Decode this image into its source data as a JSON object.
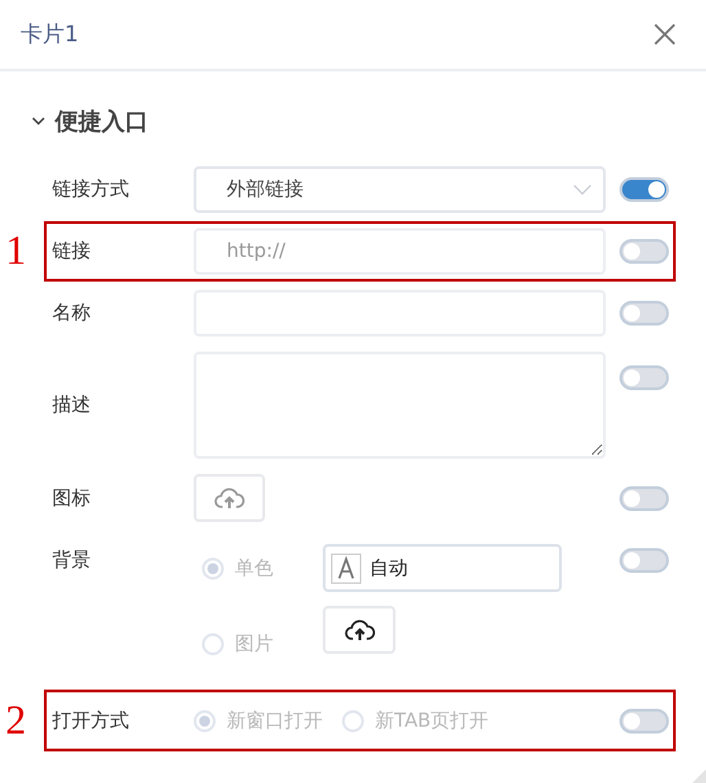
{
  "dialog": {
    "title": "卡片1"
  },
  "section": {
    "title": "便捷入口",
    "expanded": true
  },
  "fields": [
    {
      "kind": "select",
      "label": "链接方式",
      "value": "外部链接",
      "on": true
    },
    {
      "kind": "input",
      "label": "链接",
      "placeholder": "http://",
      "on": false,
      "annotation": "1"
    },
    {
      "kind": "input",
      "label": "名称",
      "on": false
    },
    {
      "kind": "textarea",
      "label": "描述",
      "on": false
    },
    {
      "kind": "upload",
      "label": "图标",
      "on": false
    },
    {
      "kind": "background",
      "label": "背景",
      "on": false,
      "options": [
        {
          "label": "单色",
          "selected": true
        },
        {
          "label": "图片",
          "selected": false
        }
      ],
      "color_value": "自动"
    },
    {
      "kind": "radio",
      "label": "打开方式",
      "on": false,
      "annotation": "2",
      "options": [
        {
          "label": "新窗口打开",
          "selected": true
        },
        {
          "label": "新TAB页打开",
          "selected": false
        }
      ]
    }
  ]
}
